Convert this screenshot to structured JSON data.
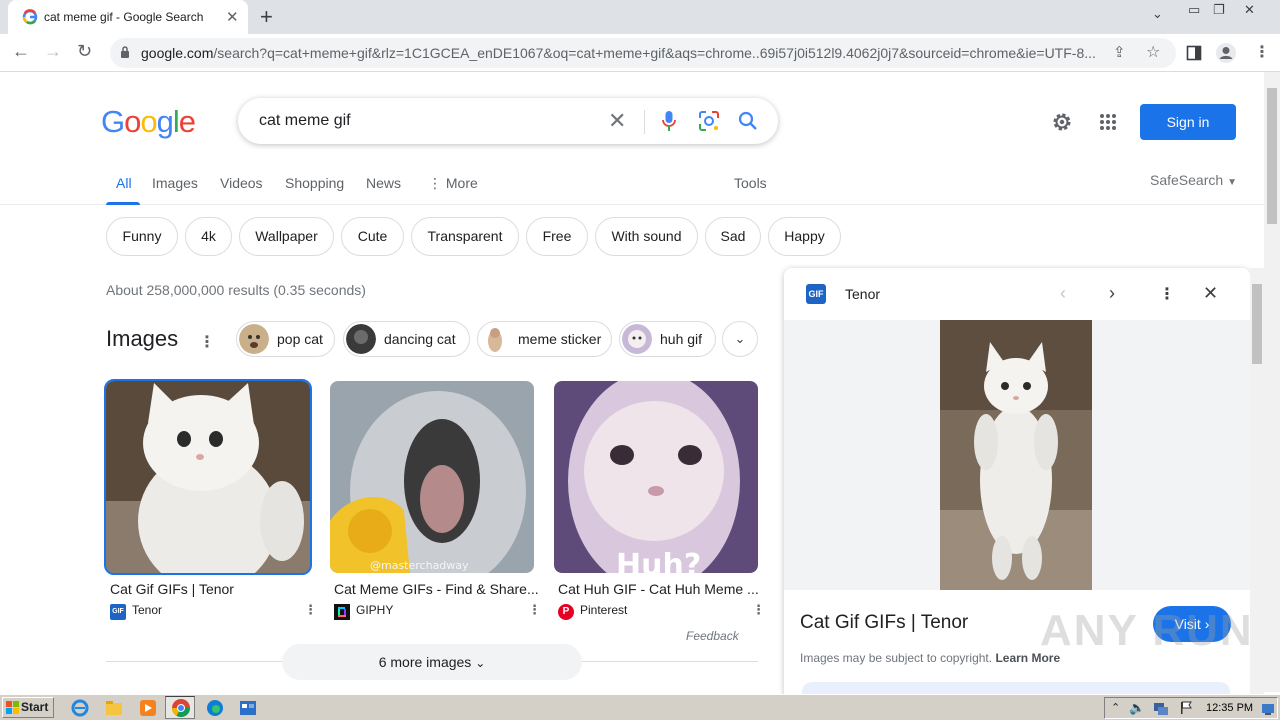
{
  "browser": {
    "tab_title": "cat meme gif - Google Search",
    "url_domain": "google.com",
    "url_rest": "/search?q=cat+meme+gif&rlz=1C1GCEA_enDE1067&oq=cat+meme+gif&aqs=chrome..69i57j0i512l9.4062j0j7&sourceid=chrome&ie=UTF-8..."
  },
  "google": {
    "logo_letters": [
      "G",
      "o",
      "o",
      "g",
      "l",
      "e"
    ],
    "logo_colors": [
      "#4285f4",
      "#ea4335",
      "#fbbc05",
      "#4285f4",
      "#34a853",
      "#ea4335"
    ],
    "query": "cat meme gif",
    "sign_in": "Sign in",
    "accent": "#1a73e8"
  },
  "nav": {
    "tabs": [
      "All",
      "Images",
      "Videos",
      "Shopping",
      "News",
      "More"
    ],
    "active": "All",
    "tools": "Tools",
    "safesearch": "SafeSearch"
  },
  "chips": [
    "Funny",
    "4k",
    "Wallpaper",
    "Cute",
    "Transparent",
    "Free",
    "With sound",
    "Sad",
    "Happy"
  ],
  "stats": "About 258,000,000 results (0.35 seconds)",
  "images_section": {
    "title": "Images",
    "related": [
      "pop cat",
      "dancing cat",
      "meme sticker",
      "huh gif"
    ],
    "results": [
      {
        "caption": "Cat Gif GIFs | Tenor",
        "source": "Tenor",
        "source_icon": "GIF"
      },
      {
        "caption": "Cat Meme GIFs - Find & Share...",
        "source": "GIPHY",
        "source_icon": ""
      },
      {
        "caption": "Cat Huh GIF - Cat Huh Meme ...",
        "source": "Pinterest",
        "source_icon": "P"
      }
    ],
    "thumb_watermarks": [
      "",
      "@masterchadway",
      "Huh?"
    ],
    "feedback": "Feedback",
    "more_images": "6 more images"
  },
  "side_panel": {
    "source_badge": "GIF",
    "source": "Tenor",
    "title": "Cat Gif GIFs | Tenor",
    "visit": "Visit",
    "copyright": "Images may be subject to copyright.",
    "learn_more": "Learn More"
  },
  "watermark": "ANY RUN",
  "taskbar": {
    "start": "Start",
    "clock": "12:35 PM"
  }
}
